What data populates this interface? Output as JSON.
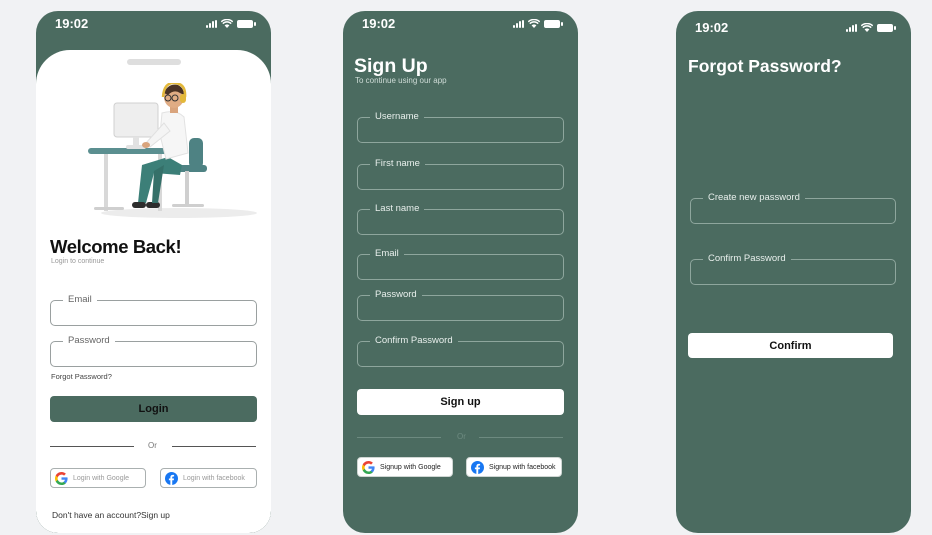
{
  "login": {
    "time": "19:02",
    "title": "Welcome Back!",
    "subtitle": "Login to continue",
    "email_label": "Email",
    "password_label": "Password",
    "forgot_link": "Forgot Password?",
    "login_button": "Login",
    "or_text": "Or",
    "google_button": "Login with Google",
    "facebook_button": "Login with facebook",
    "signup_prompt": "Don't have an account?Sign up"
  },
  "signup": {
    "time": "19:02",
    "title": "Sign Up",
    "subtitle": "To continue using our app",
    "fields": [
      "Username",
      "First name",
      "Last name",
      "Email",
      "Password",
      "Confirm Password"
    ],
    "signup_button": "Sign up",
    "or_text": "Or",
    "google_button": "Signup with Google",
    "facebook_button": "Signup with facebook"
  },
  "forgot": {
    "time": "19:02",
    "title": "Forgot Password?",
    "new_password_label": "Create new password",
    "confirm_password_label": "Confirm Password",
    "confirm_button": "Confirm"
  },
  "colors": {
    "primary_green": "#4b6b60",
    "background": "#f1f2f4",
    "card": "#ffffff"
  }
}
